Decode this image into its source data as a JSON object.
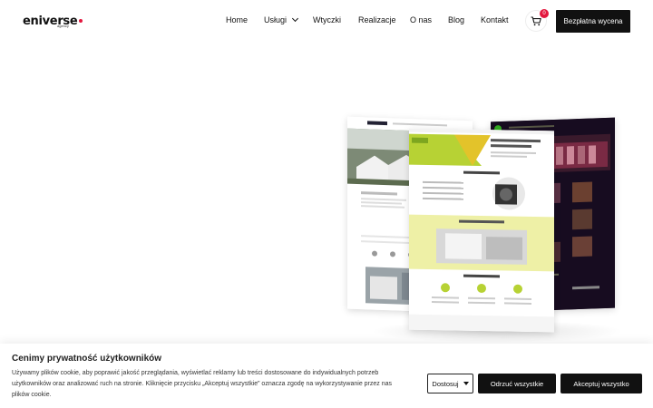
{
  "brand": {
    "logo": "eniverse",
    "sub": "agency",
    "accent": "#e3173e"
  },
  "nav": {
    "items": [
      {
        "label": "Home"
      },
      {
        "label": "Usługi"
      },
      {
        "label": "Wtyczki"
      },
      {
        "label": "Realizacje"
      },
      {
        "label": "O nas"
      },
      {
        "label": "Blog"
      },
      {
        "label": "Kontakt"
      }
    ],
    "cart_count": "0",
    "cta_label": "Bezpłatna wycena"
  },
  "cookie": {
    "title": "Cenimy prywatność użytkowników",
    "text": "Używamy plików cookie, aby poprawić jakość przeglądania, wyświetlać reklamy lub treści dostosowane do indywidualnych potrzeb użytkowników oraz analizować ruch na stronie. Kliknięcie przycisku „Akceptuj wszystkie” oznacza zgodę na wykorzystywanie przez nas plików cookie.",
    "customize_label": "Dostosuj",
    "reject_label": "Odrzuć wszystkie",
    "accept_label": "Akceptuj wszystko"
  }
}
